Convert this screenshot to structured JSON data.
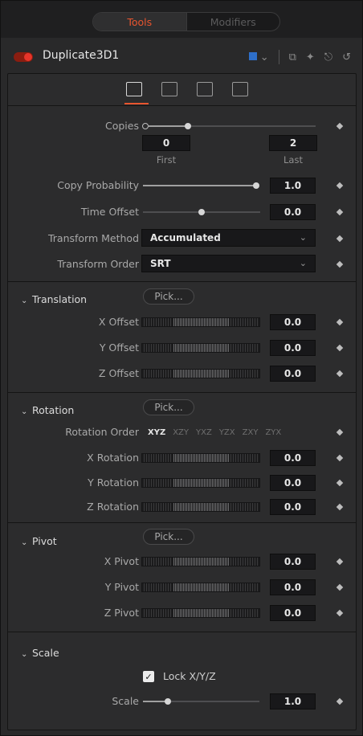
{
  "tabs": {
    "tools": "Tools",
    "modifiers": "Modifiers"
  },
  "header": {
    "title": "Duplicate3D1",
    "color_swatch": "#2e6fc9",
    "accent": "#e8552f"
  },
  "copies": {
    "label": "Copies",
    "first": "0",
    "last": "2",
    "first_label": "First",
    "last_label": "Last"
  },
  "copy_probability": {
    "label": "Copy Probability",
    "value": "1.0",
    "level": 1.0
  },
  "time_offset": {
    "label": "Time Offset",
    "value": "0.0",
    "level": 0.5
  },
  "transform_method": {
    "label": "Transform Method",
    "value": "Accumulated"
  },
  "transform_order": {
    "label": "Transform Order",
    "value": "SRT"
  },
  "translation": {
    "title": "Translation",
    "pick": "Pick...",
    "rows": [
      {
        "label": "X Offset",
        "value": "0.0"
      },
      {
        "label": "Y Offset",
        "value": "0.0"
      },
      {
        "label": "Z Offset",
        "value": "0.0"
      }
    ]
  },
  "rotation": {
    "title": "Rotation",
    "pick": "Pick...",
    "order_label": "Rotation Order",
    "orders": [
      "XYZ",
      "XZY",
      "YXZ",
      "YZX",
      "ZXY",
      "ZYX"
    ],
    "selected_order": "XYZ",
    "rows": [
      {
        "label": "X Rotation",
        "value": "0.0"
      },
      {
        "label": "Y Rotation",
        "value": "0.0"
      },
      {
        "label": "Z Rotation",
        "value": "0.0"
      }
    ]
  },
  "pivot": {
    "title": "Pivot",
    "pick": "Pick...",
    "rows": [
      {
        "label": "X Pivot",
        "value": "0.0"
      },
      {
        "label": "Y Pivot",
        "value": "0.0"
      },
      {
        "label": "Z Pivot",
        "value": "0.0"
      }
    ]
  },
  "scale": {
    "title": "Scale",
    "lock_label": "Lock X/Y/Z",
    "lock_checked": true,
    "label": "Scale",
    "value": "1.0",
    "level": 0.2
  }
}
